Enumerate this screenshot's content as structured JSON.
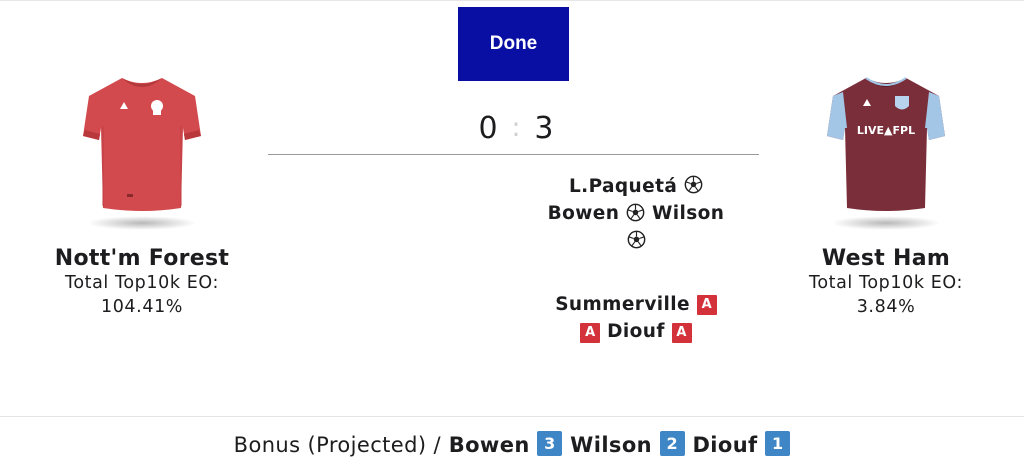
{
  "status_button_label": "Done",
  "home": {
    "name": "Nott'm Forest",
    "eo_label": "Total Top10k EO:",
    "eo_value": "104.41%",
    "shirt_color": "#d24a4d",
    "shirt_icon": "red-jersey-icon"
  },
  "away": {
    "name": "West Ham",
    "eo_label": "Total Top10k EO:",
    "eo_value": "3.84%",
    "shirt_color": "#7a2e3a",
    "sleeve_color": "#9fc4e6",
    "shirt_sponsor": "LIVE▲FPL",
    "shirt_icon": "claret-jersey-icon"
  },
  "score": {
    "home": "0",
    "separator": ":",
    "away": "3"
  },
  "goals": {
    "scorers": [
      "L.Paquetá",
      "Bowen",
      "Wilson"
    ],
    "icon": "football-icon"
  },
  "assists": {
    "players": [
      "Summerville",
      "Diouf"
    ],
    "badge_text": "A",
    "badge_color": "#d3323a"
  },
  "bonus": {
    "title": "Bonus (Projected) /",
    "badge_color": "#3f86c6",
    "players": [
      {
        "name": "Bowen",
        "points": "3"
      },
      {
        "name": "Wilson",
        "points": "2"
      },
      {
        "name": "Diouf",
        "points": "1"
      }
    ]
  }
}
